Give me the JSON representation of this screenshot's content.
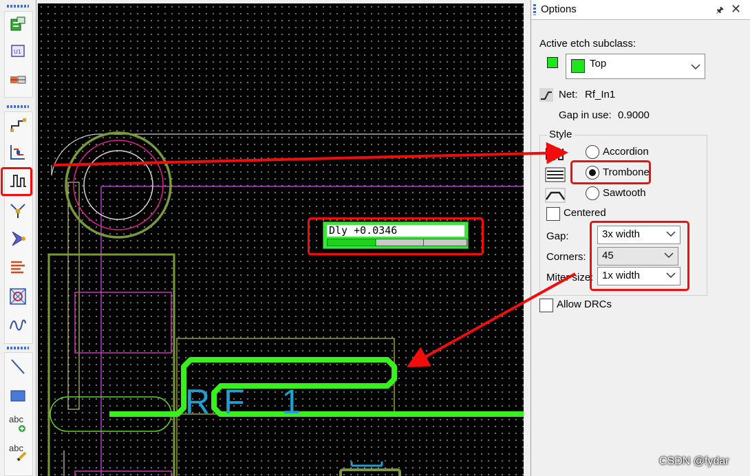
{
  "toolbar": {
    "tools": [
      {
        "name": "place-manual-icon"
      },
      {
        "name": "component-u1-icon"
      },
      {
        "name": "place-package-icon"
      },
      {
        "name": "add-connect-icon"
      },
      {
        "name": "slide-icon"
      },
      {
        "name": "delay-tune-icon",
        "active": true
      },
      {
        "name": "vertex-icon"
      },
      {
        "name": "fanout-icon"
      },
      {
        "name": "spread-icon"
      },
      {
        "name": "custom-smooth-icon"
      },
      {
        "name": "phase-tune-icon"
      },
      {
        "name": "add-line-icon"
      },
      {
        "name": "add-rect-icon"
      },
      {
        "name": "add-text-icon",
        "text": "abc"
      },
      {
        "name": "edit-text-icon",
        "text": "abc"
      }
    ]
  },
  "canvas": {
    "delay_meter": {
      "text": "Dly +0.0346",
      "fill_fraction": 0.35
    },
    "refdes_label": "RF 1"
  },
  "options": {
    "title": "Options",
    "active_etch_label": "Active etch subclass:",
    "subclass_value": "Top",
    "net_label": "Net:",
    "net_value": "Rf_In1",
    "gap_in_use_label": "Gap in use:",
    "gap_in_use_value": "0.9000",
    "style_label": "Style",
    "styles": [
      {
        "label": "Accordion",
        "selected": false
      },
      {
        "label": "Trombone",
        "selected": true
      },
      {
        "label": "Sawtooth",
        "selected": false
      }
    ],
    "centered_label": "Centered",
    "gap_label": "Gap:",
    "gap_value": "3x width",
    "corners_label": "Corners:",
    "corners_value": "45",
    "miter_label": "Miter size:",
    "miter_value": "1x width",
    "allow_drcs_label": "Allow DRCs"
  },
  "colors": {
    "highlight": "#f20d0d",
    "etch_green": "#1de61d",
    "trace_green": "#39f01f"
  },
  "watermark": "CSDN @fydar"
}
